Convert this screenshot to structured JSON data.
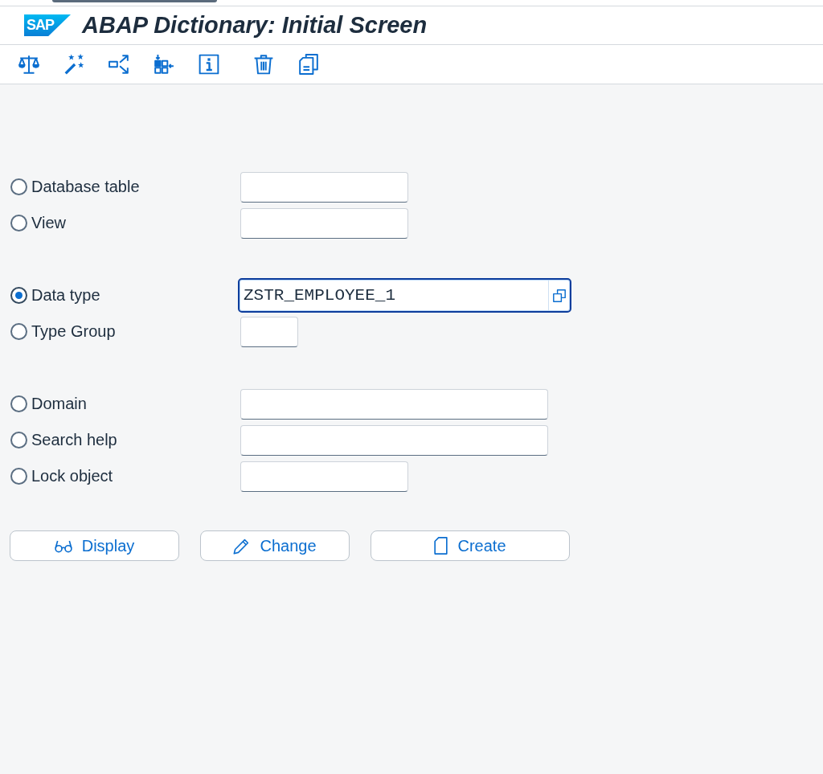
{
  "window": {
    "logo": "SAP",
    "title": "ABAP Dictionary: Initial Screen"
  },
  "groups": [
    {
      "options": [
        {
          "label": "Database table",
          "selected": false,
          "focused": false
        },
        {
          "label": "View",
          "selected": false,
          "focused": false
        }
      ]
    },
    {
      "options": [
        {
          "label": "Data type",
          "selected": true,
          "focused": true,
          "value": "ZSTR_EMPLOYEE_1"
        },
        {
          "label": "Type Group",
          "selected": false,
          "focused": false
        }
      ]
    },
    {
      "options": [
        {
          "label": "Domain",
          "selected": false,
          "focused": false
        },
        {
          "label": "Search help",
          "selected": false,
          "focused": false
        },
        {
          "label": "Lock object",
          "selected": false,
          "focused": false
        }
      ]
    }
  ],
  "buttons": [
    {
      "label": "Display"
    },
    {
      "label": "Change"
    },
    {
      "label": "Create"
    }
  ]
}
